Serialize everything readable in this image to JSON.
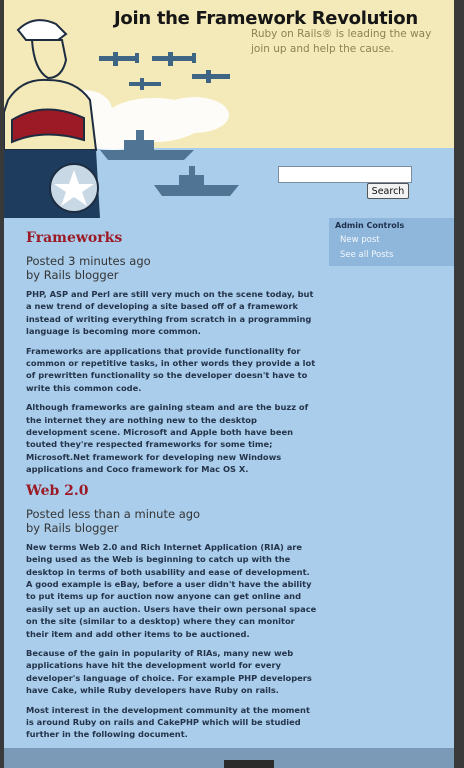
{
  "header": {
    "title": "Join the Framework Revolution",
    "tagline": "Ruby on Rails® is leading the way join up and help the cause."
  },
  "search": {
    "placeholder": "",
    "button_label": "Search"
  },
  "sidebar": {
    "title": "Admin Controls",
    "links": [
      "New post",
      "See all Posts"
    ]
  },
  "posts": [
    {
      "title": "Frameworks",
      "posted": "Posted 3 minutes ago",
      "author": "by Rails blogger",
      "paragraphs": [
        "PHP, ASP and Perl are still very much on the scene today, but a new trend of developing a site based off of a framework instead of writing everything from scratch in a programming language is becoming more common.",
        "Frameworks are applications that provide functionality for common or repetitive tasks, in other words they provide a lot of prewritten functionality so the developer doesn't have to write this common code.",
        "Although frameworks are gaining steam and are the buzz of the internet they are nothing new to the desktop development scene. Microsoft and Apple both have been touted they're respected frameworks for some time; Microsoft.Net framework for developing new Windows applications and Coco framework for Mac OS X."
      ]
    },
    {
      "title": "Web 2.0",
      "posted": "Posted less than a minute ago",
      "author": "by Rails blogger",
      "paragraphs": [
        "New terms Web 2.0 and Rich Internet Application (RIA) are being used as the Web is beginning to catch up with the desktop in terms of both usability and ease of development. A good example is eBay, before a user didn't have the ability to put items up for auction now anyone can get online and easily set up an auction. Users have their own personal space on the site (similar to a desktop) where they can monitor their item and add other items to be auctioned.",
        "Because of the gain in popularity of RIAs, many new web applications have hit the development world for every developer's language of choice. For example PHP developers have Cake, while Ruby developers have Ruby on rails.",
        "Most interest in the development community at the moment is around Ruby on rails and CakePHP which will be studied further in the following document."
      ]
    }
  ]
}
